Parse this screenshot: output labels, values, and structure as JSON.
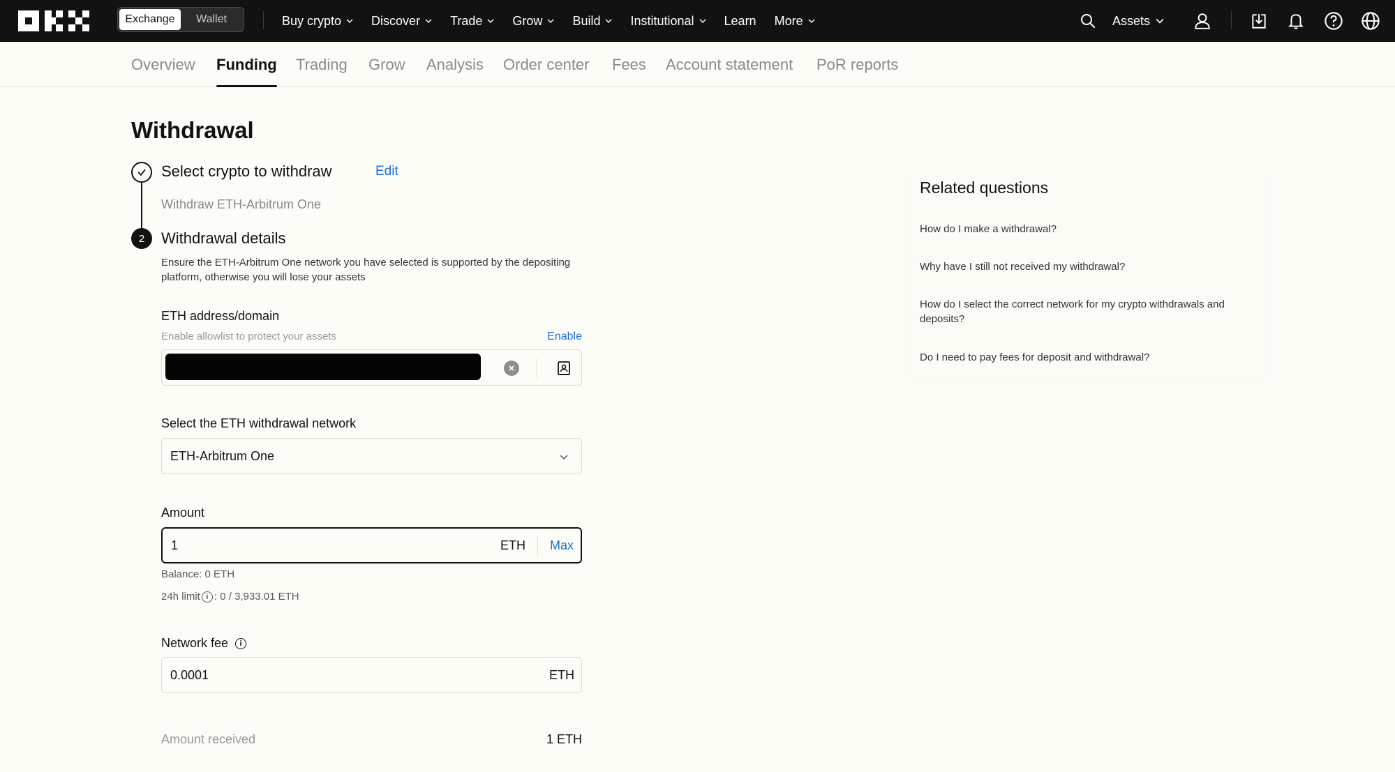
{
  "topnav": {
    "mode_exchange": "Exchange",
    "mode_wallet": "Wallet",
    "menu": [
      {
        "label": "Buy crypto",
        "dropdown": true
      },
      {
        "label": "Discover",
        "dropdown": true
      },
      {
        "label": "Trade",
        "dropdown": true
      },
      {
        "label": "Grow",
        "dropdown": true
      },
      {
        "label": "Build",
        "dropdown": true
      },
      {
        "label": "Institutional",
        "dropdown": true
      },
      {
        "label": "Learn",
        "dropdown": false
      },
      {
        "label": "More",
        "dropdown": true
      }
    ],
    "assets_label": "Assets",
    "icons": [
      "search-icon",
      "user-icon",
      "download-icon",
      "bell-icon",
      "help-icon",
      "globe-icon"
    ]
  },
  "subnav": {
    "tabs": [
      "Overview",
      "Funding",
      "Trading",
      "Grow",
      "Analysis",
      "Order center",
      "Fees",
      "Account statement",
      "PoR reports"
    ],
    "active": "Funding"
  },
  "page": {
    "title": "Withdrawal",
    "step1": {
      "title": "Select crypto to withdraw",
      "edit": "Edit",
      "summary": "Withdraw ETH-Arbitrum One"
    },
    "step2": {
      "number": "2",
      "title": "Withdrawal details",
      "warning": "Ensure the ETH-Arbitrum One network you have selected is supported by the depositing platform, otherwise you will lose your assets"
    },
    "address": {
      "label": "ETH address/domain",
      "hint": "Enable allowlist to protect your assets",
      "enable": "Enable"
    },
    "network": {
      "label": "Select the ETH withdrawal network",
      "value": "ETH-Arbitrum One"
    },
    "amount": {
      "label": "Amount",
      "value": "1",
      "unit": "ETH",
      "max": "Max",
      "balance": "Balance: 0 ETH",
      "limit_label": "24h limit",
      "limit_value": ": 0 / 3,933.01 ETH"
    },
    "fee": {
      "label": "Network fee",
      "value": "0.0001",
      "unit": "ETH"
    },
    "received": {
      "label": "Amount received",
      "value": "1 ETH"
    }
  },
  "related": {
    "title": "Related questions",
    "questions": [
      "How do I make a withdrawal?",
      "Why have I still not received my withdrawal?",
      "How do I select the correct network for my crypto withdrawals and deposits?",
      "Do I need to pay fees for deposit and withdrawal?"
    ]
  },
  "colors": {
    "nav_bg": "#121212",
    "page_bg": "#fdfdf8",
    "link": "#1c6fd8"
  }
}
